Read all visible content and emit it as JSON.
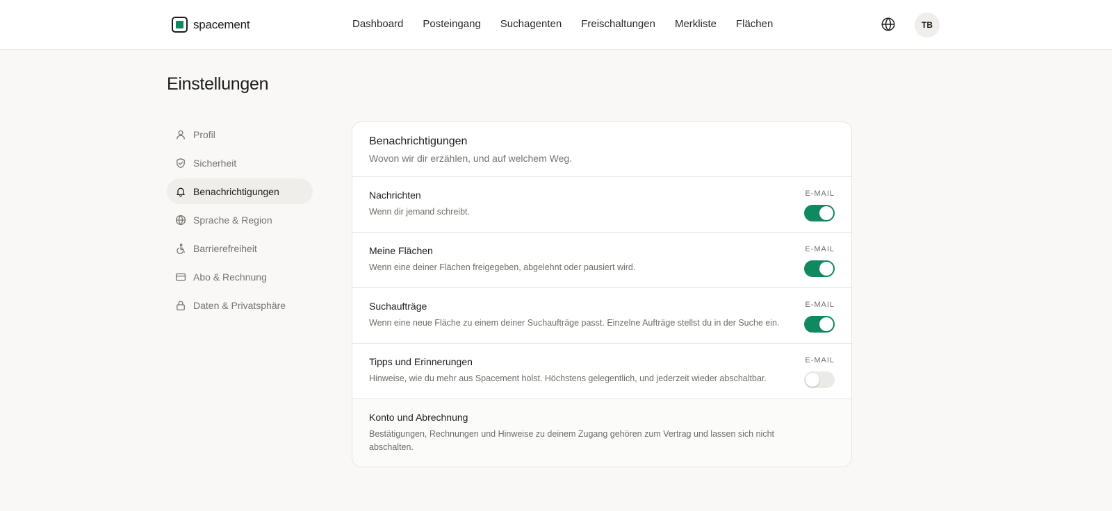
{
  "brand": {
    "name": "spacement",
    "accent_color": "#0f8a5f"
  },
  "nav": {
    "items": [
      {
        "label": "Dashboard"
      },
      {
        "label": "Posteingang"
      },
      {
        "label": "Suchagenten"
      },
      {
        "label": "Freischaltungen"
      },
      {
        "label": "Merkliste"
      },
      {
        "label": "Flächen"
      }
    ],
    "language_icon": "globe-icon",
    "avatar_initials": "TB"
  },
  "page": {
    "title": "Einstellungen"
  },
  "sidebar": {
    "items": [
      {
        "label": "Profil",
        "icon": "user-icon",
        "active": false
      },
      {
        "label": "Sicherheit",
        "icon": "shield-check-icon",
        "active": false
      },
      {
        "label": "Benachrichtigungen",
        "icon": "bell-icon",
        "active": true
      },
      {
        "label": "Sprache & Region",
        "icon": "globe-icon",
        "active": false
      },
      {
        "label": "Barrierefreiheit",
        "icon": "accessibility-icon",
        "active": false
      },
      {
        "label": "Abo & Rechnung",
        "icon": "credit-card-icon",
        "active": false
      },
      {
        "label": "Daten & Privatsphäre",
        "icon": "lock-icon",
        "active": false
      }
    ]
  },
  "notifications": {
    "title": "Benachrichtigungen",
    "subtitle": "Wovon wir dir erzählen, und auf welchem Weg.",
    "rows": [
      {
        "title": "Nachrichten",
        "description": "Wenn dir jemand schreibt.",
        "channel": "E-MAIL",
        "enabled": true
      },
      {
        "title": "Meine Flächen",
        "description": "Wenn eine deiner Flächen freigegeben, abgelehnt oder pausiert wird.",
        "channel": "E-MAIL",
        "enabled": true
      },
      {
        "title": "Suchaufträge",
        "description": "Wenn eine neue Fläche zu einem deiner Suchaufträge passt. Einzelne Aufträge stellst du in der Suche ein.",
        "channel": "E-MAIL",
        "enabled": true
      },
      {
        "title": "Tipps und Erinnerungen",
        "description": "Hinweise, wie du mehr aus Spacement holst. Höchstens gelegentlich, und jederzeit wieder abschaltbar.",
        "channel": "E-MAIL",
        "enabled": false
      }
    ],
    "account_row": {
      "title": "Konto und Abrechnung",
      "description": "Bestätigungen, Rechnungen und Hinweise zu deinem Zugang gehören zum Vertrag und lassen sich nicht abschalten."
    }
  }
}
